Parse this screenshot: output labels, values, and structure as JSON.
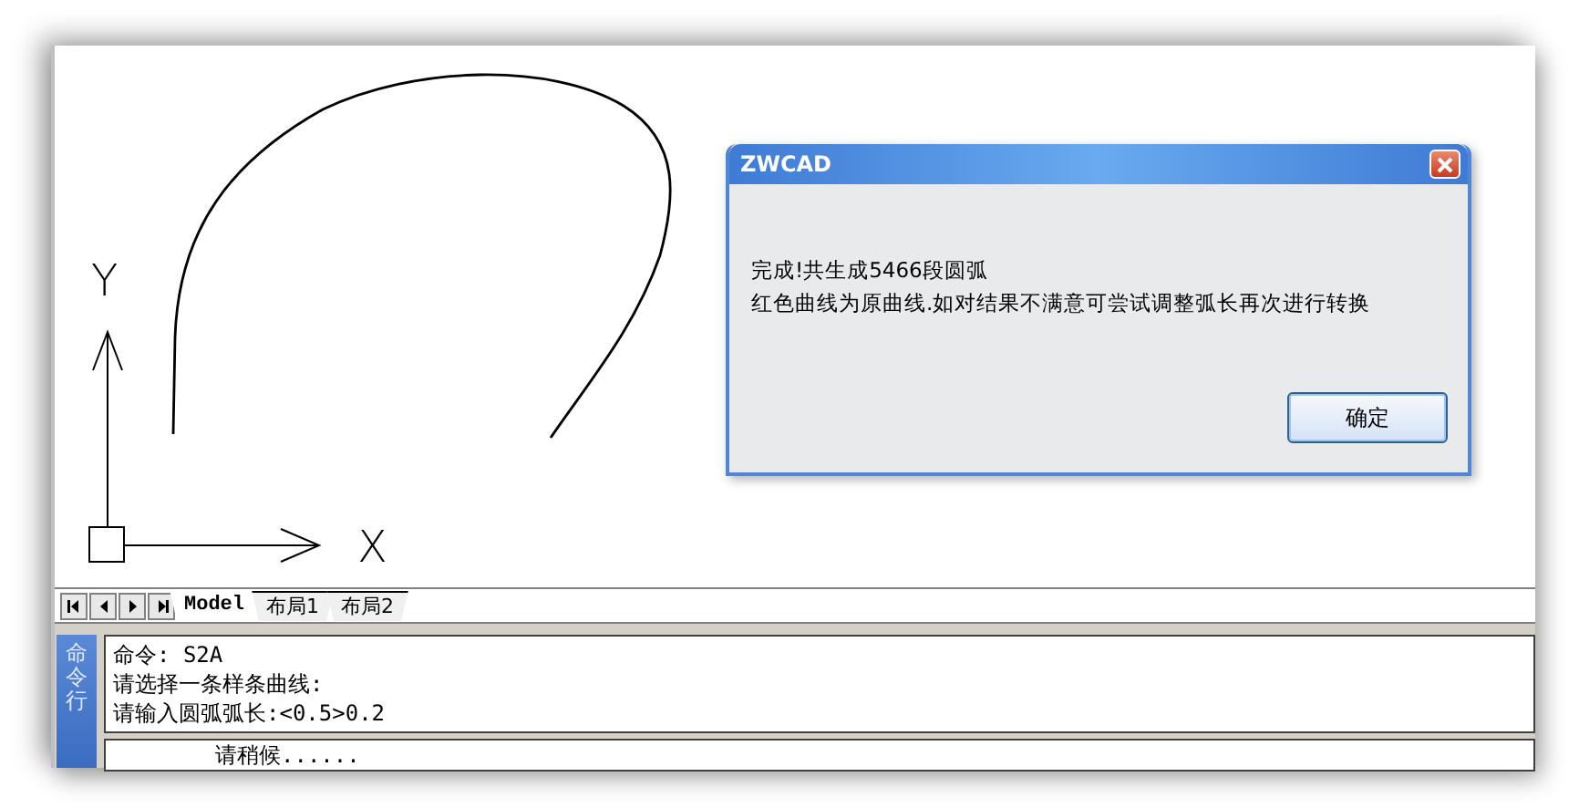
{
  "drawing": {
    "y_label": "Y",
    "x_label": "X"
  },
  "tabs": [
    {
      "label": "Model",
      "selected": true
    },
    {
      "label": "布局1",
      "selected": false
    },
    {
      "label": "布局2",
      "selected": false
    }
  ],
  "command_panel": {
    "title": "命令行",
    "history": [
      "命令: S2A",
      "请选择一条样条曲线:",
      "请输入圆弧弧长:<0.5>0.2"
    ],
    "prompt": "请稍候......"
  },
  "dialog": {
    "title": "ZWCAD",
    "message": [
      "完成!共生成5466段圆弧",
      "红色曲线为原曲线.如对结果不满意可尝试调整弧长再次进行转换"
    ],
    "button": "确定"
  }
}
